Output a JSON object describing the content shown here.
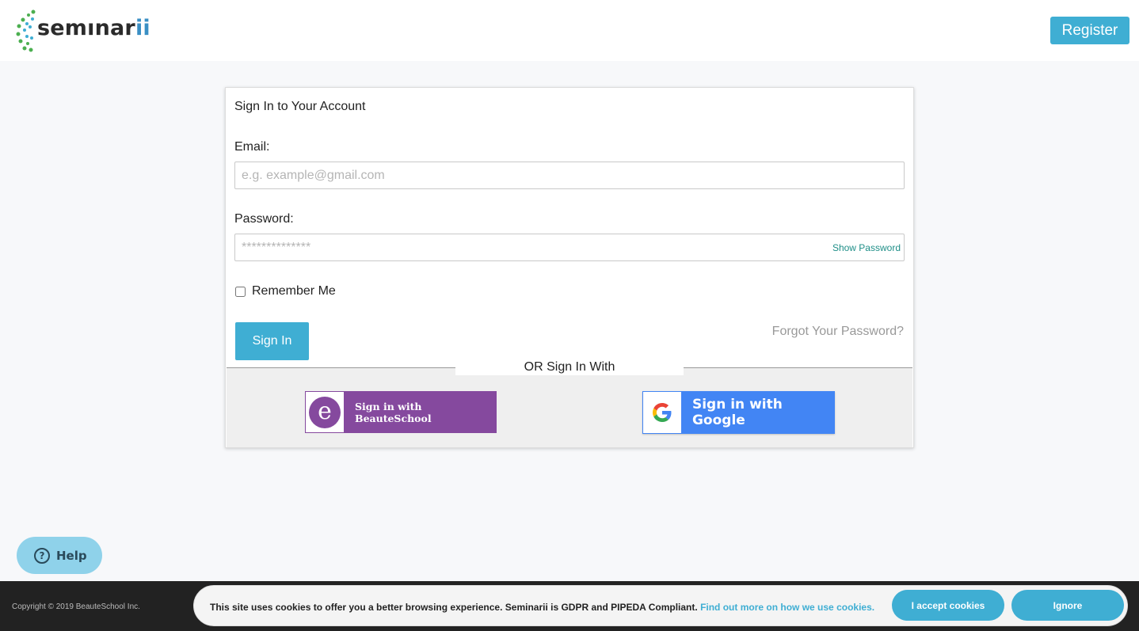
{
  "header": {
    "logo_text_main": "semınar",
    "logo_text_accent": "ii",
    "register_label": "Register"
  },
  "login": {
    "title": "Sign In to Your Account",
    "email_label": "Email:",
    "email_placeholder": "e.g. example@gmail.com",
    "email_value": "",
    "password_label": "Password:",
    "password_placeholder": "**************",
    "password_value": "",
    "show_password_label": "Show Password",
    "remember_label": "Remember Me",
    "remember_checked": false,
    "signin_label": "Sign In",
    "forgot_label": "Forgot Your Password?",
    "or_label": "OR Sign In With",
    "beauteschool_label": "Sign in with BeauteSchool",
    "beauteschool_icon_letter": "e",
    "google_label": "Sign in with Google"
  },
  "help": {
    "label": "Help",
    "icon_glyph": "?"
  },
  "footer": {
    "copyright": "Copyright © 2019 BeauteSchool Inc.",
    "cookie_text": "This site uses cookies to offer you a better browsing experience. Seminarii is GDPR and PIPEDA Compliant.",
    "cookie_link": "Find out more on how we use cookies.",
    "accept_label": "I accept cookies",
    "ignore_label": "Ignore"
  },
  "colors": {
    "accent": "#3faed3",
    "beauteschool": "#85499e",
    "google_blue": "#4285f4",
    "link_teal": "#1f8f88"
  }
}
